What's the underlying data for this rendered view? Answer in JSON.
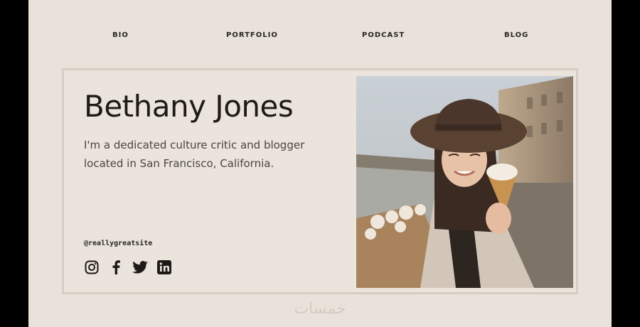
{
  "nav": {
    "items": [
      "BIO",
      "PORTFOLIO",
      "PODCAST",
      "BLOG"
    ]
  },
  "profile": {
    "name": "Bethany Jones",
    "bio": "I'm a dedicated culture critic and blogger located in San Francisco, California.",
    "handle": "@reallygreatsite"
  },
  "social": {
    "icons": [
      "instagram-icon",
      "facebook-icon",
      "twitter-icon",
      "linkedin-icon"
    ]
  },
  "watermark": "خمسات",
  "colors": {
    "background": "#e9e2da",
    "text": "#1e1a17",
    "border": "#d6cdc3"
  }
}
